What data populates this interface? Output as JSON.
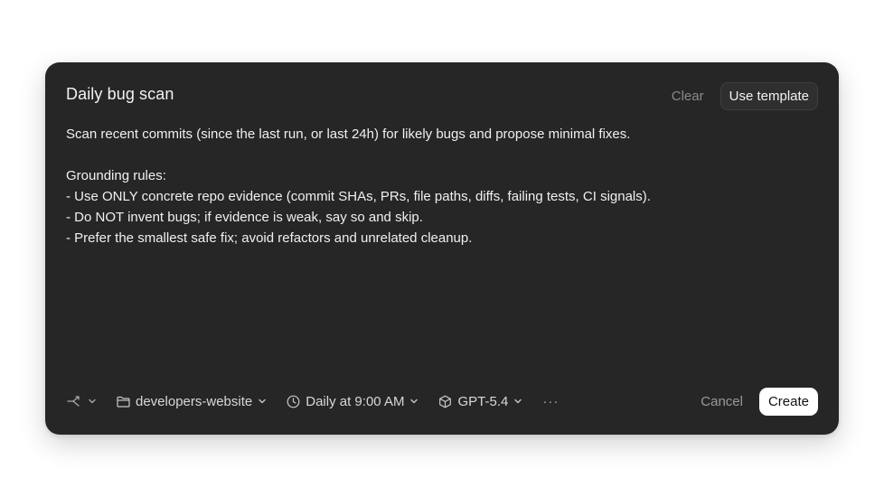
{
  "dialog": {
    "title": "Daily bug scan",
    "clear_label": "Clear",
    "use_template_label": "Use template",
    "prompt_text": "Scan recent commits (since the last run, or last 24h) for likely bugs and propose minimal fixes.\n\nGrounding rules:\n- Use ONLY concrete repo evidence (commit SHAs, PRs, file paths, diffs, failing tests, CI signals).\n- Do NOT invent bugs; if evidence is weak, say so and skip.\n- Prefer the smallest safe fix; avoid refactors and unrelated cleanup."
  },
  "footer": {
    "branch_icon": "branch-icon",
    "project_label": "developers-website",
    "schedule_label": "Daily at 9:00 AM",
    "model_label": "GPT-5.4",
    "more_label": "···",
    "cancel_label": "Cancel",
    "create_label": "Create"
  },
  "colors": {
    "dialog_bg": "#262626",
    "primary_button_bg": "#ffffff",
    "muted_text": "#8a8a8a"
  }
}
